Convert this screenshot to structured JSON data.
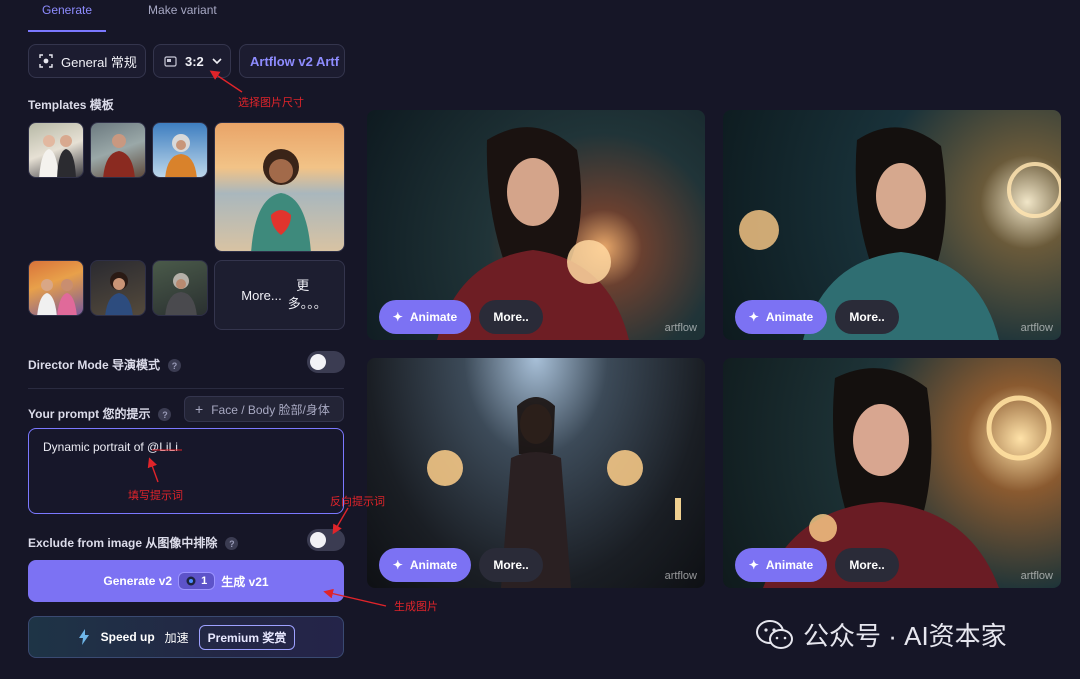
{
  "tabs": [
    {
      "label": "Generate",
      "active": true
    },
    {
      "label": "Make variant",
      "active": false
    }
  ],
  "toolbar": {
    "mode_label": "General 常规",
    "ratio_label": "3:2",
    "model_label": "Artflow v2 Artf"
  },
  "templates": {
    "label": "Templates 模板",
    "more_label": "More...",
    "more_cn": "更多。。。"
  },
  "director": {
    "label": "Director Mode 导演模式",
    "enabled": false
  },
  "prompt": {
    "label": "Your prompt 您的提示",
    "face_body_button": "Face / Body 脸部/身体",
    "value": "Dynamic portrait of @LiLi"
  },
  "exclude": {
    "label": "Exclude from image 从图像中排除",
    "enabled": false
  },
  "generate": {
    "label": "Generate v2",
    "cost": "1",
    "suffix": "生成 v21"
  },
  "speed": {
    "label": "Speed up",
    "cn": "加速",
    "premium_label": "Premium 奖赏"
  },
  "cards": [
    {
      "animate_label": "Animate",
      "more_label": "More..",
      "watermark": "artflow"
    },
    {
      "animate_label": "Animate",
      "more_label": "More..",
      "watermark": "artflow"
    },
    {
      "animate_label": "Animate",
      "more_label": "More..",
      "watermark": "artflow"
    },
    {
      "animate_label": "Animate",
      "more_label": "More..",
      "watermark": "artflow"
    }
  ],
  "annotations": {
    "ratio": "选择图片尺寸",
    "prompt": "填写提示词",
    "negative": "反向提示词",
    "generate": "生成图片"
  },
  "wechat": {
    "text": "公众号 · AI资本家"
  },
  "colors": {
    "accent": "#7c72f3",
    "background": "#161627",
    "annotation": "#e0242a"
  }
}
